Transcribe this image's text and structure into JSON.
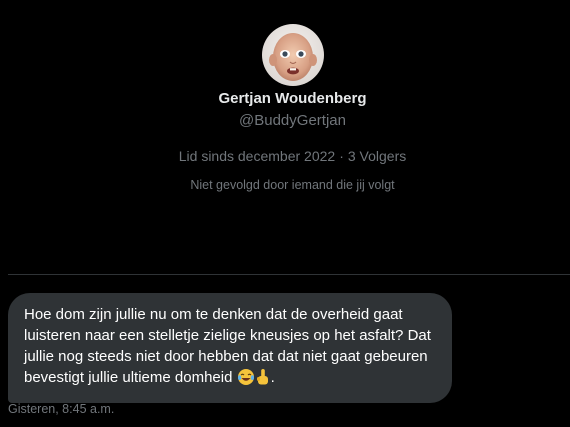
{
  "profile": {
    "avatar_icon": "profile-photo-avatar",
    "display_name": "Gertjan Woudenberg",
    "handle": "@BuddyGertjan",
    "member_since": "Lid sinds december 2022",
    "separator": "·",
    "followers": "3 Volgers",
    "not_followed_text": "Niet gevolgd door iemand die jij volgt"
  },
  "message": {
    "text": "Hoe dom zijn jullie nu om te denken dat de overheid gaat luisteren naar een stelletje zielige kneusjes op het asfalt? Dat jullie nog steeds niet door hebben dat dat niet gaat gebeuren bevestigt jullie ultieme domheid",
    "emojis": [
      "laughing-tears-emoji-icon",
      "middle-finger-emoji-icon"
    ],
    "trailing": ".",
    "timestamp": "Gisteren, 8:45 a.m."
  },
  "colors": {
    "background": "#000000",
    "bubble": "#2f3336",
    "primary_text": "#e7e9ea",
    "secondary_text": "#71767b",
    "divider": "#2f3336"
  }
}
